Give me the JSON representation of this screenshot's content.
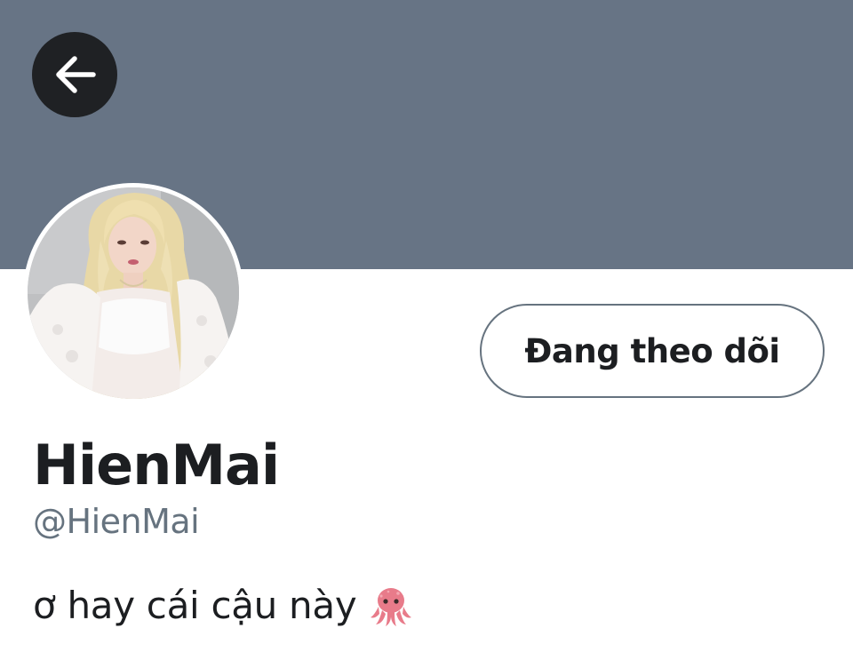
{
  "colors": {
    "banner": "#677485",
    "text_primary": "#1c1e21",
    "text_secondary": "#66737f",
    "button_border": "#66737f",
    "back_button_bg": "#1f2124",
    "icon_color": "#ffffff"
  },
  "header": {
    "back_icon": "arrow-left-icon"
  },
  "profile": {
    "avatar_icon": "profile-photo",
    "follow_button_label": "Đang theo dõi",
    "display_name": "HienMai",
    "handle": "@HienMai",
    "bio_text": "ơ hay cái cậu này",
    "bio_emoji_icon": "octopus-icon"
  }
}
